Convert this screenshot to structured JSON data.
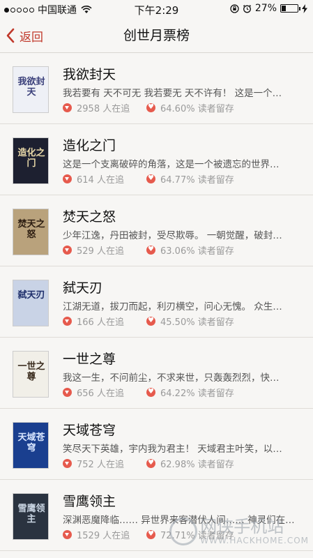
{
  "status": {
    "carrier": "中国联通",
    "time": "下午2:29",
    "battery": "27%",
    "battery_level": 0.27
  },
  "nav": {
    "back_label": "返回",
    "title": "创世月票榜"
  },
  "books": [
    {
      "title": "我欲封天",
      "desc": "我若要有 天不可无 我若要无 天不许有！ 这是一个…",
      "readers": "2958 人在追",
      "retention": "64.60% 读者留存",
      "cover_text": "我欲封天",
      "cover_bg": "#eef0f6",
      "cover_fg": "#3a3f7a"
    },
    {
      "title": "造化之门",
      "desc": "这是一个支离破碎的角落，这是一个被遗忘的世界…",
      "readers": "614 人在追",
      "retention": "64.77% 读者留存",
      "cover_text": "造化之门",
      "cover_bg": "#1d2030",
      "cover_fg": "#e9d9a8"
    },
    {
      "title": "焚天之怒",
      "desc": "少年江逸，丹田被封，受尽欺辱。 一朝觉醒，破封…",
      "readers": "529 人在追",
      "retention": "63.06% 读者留存",
      "cover_text": "焚天之怒",
      "cover_bg": "#b9a27c",
      "cover_fg": "#2b1c10"
    },
    {
      "title": "弑天刃",
      "desc": "江湖无道，拔刀而起，利刃横空，问心无愧。 众生…",
      "readers": "166 人在追",
      "retention": "45.50% 读者留存",
      "cover_text": "弑天刃",
      "cover_bg": "#c9d3e6",
      "cover_fg": "#1f2f6b"
    },
    {
      "title": "一世之尊",
      "desc": "我这一生，不问前尘，不求来世，只轰轰烈烈，快…",
      "readers": "656 人在追",
      "retention": "64.22% 读者留存",
      "cover_text": "一世之尊",
      "cover_bg": "#f1efe8",
      "cover_fg": "#3a2c1e"
    },
    {
      "title": "天域苍穹",
      "desc": "笑尽天下英雄，宇内我为君主！ 天域君主叶笑，以…",
      "readers": "752 人在追",
      "retention": "62.98% 读者留存",
      "cover_text": "天域苍穹",
      "cover_bg": "#1a3f8f",
      "cover_fg": "#d8e6ff"
    },
    {
      "title": "雪鹰领主",
      "desc": "深渊恶魔降临…… 异世界来客潜伏人间…… 神灵们在…",
      "readers": "1529 人在追",
      "retention": "72.71% 读者留存",
      "cover_text": "雪鹰领主",
      "cover_bg": "#2a3340",
      "cover_fg": "#c7d3e0"
    }
  ],
  "watermark": {
    "text": "网侠手机站",
    "url": "WWW.HACKHOME.COM"
  },
  "colors": {
    "accent": "#c0392b",
    "icon_red": "#e65a4d",
    "meta_gray": "#9a9a9a"
  }
}
